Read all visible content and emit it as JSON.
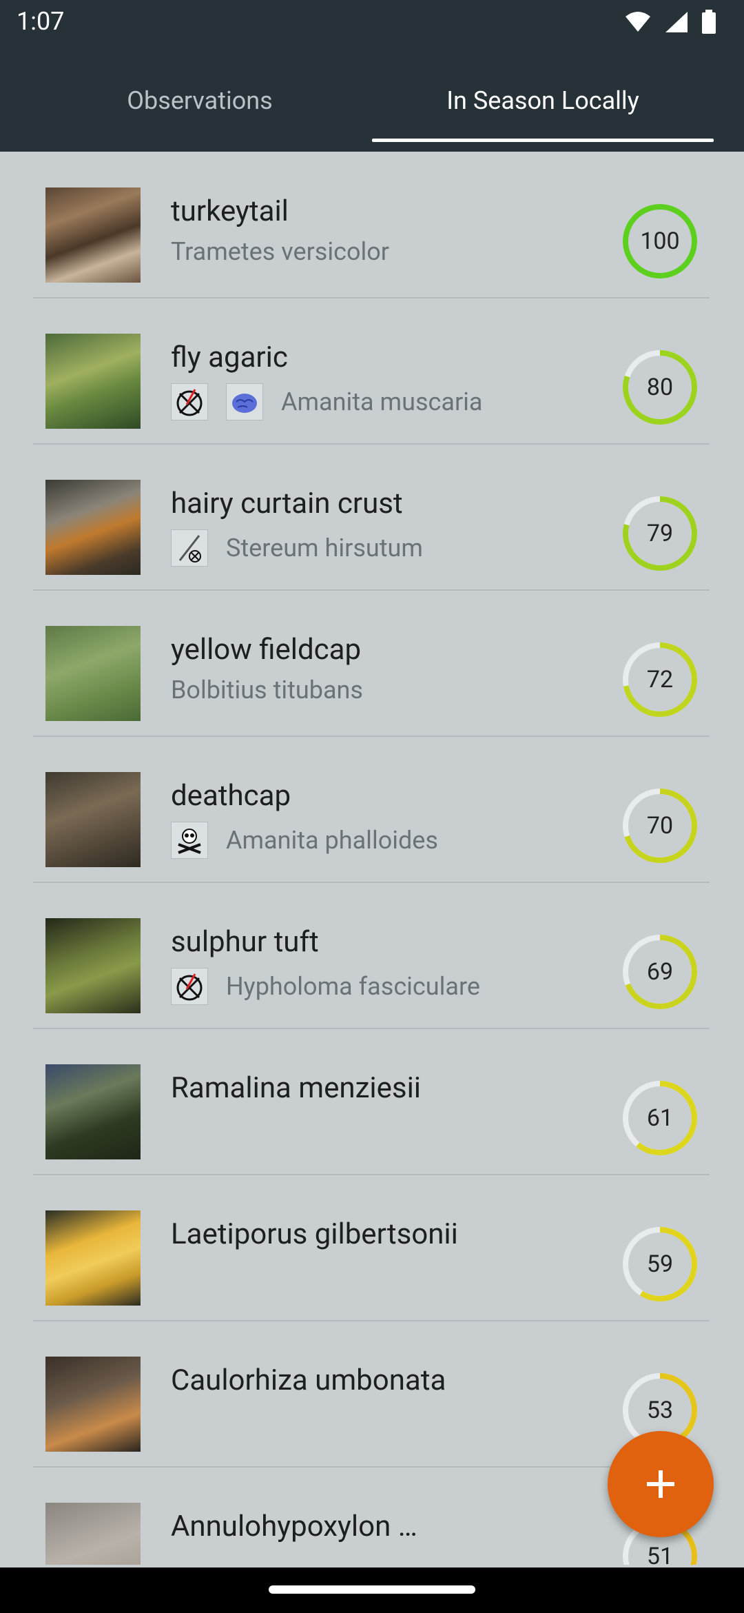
{
  "status": {
    "time": "1:07"
  },
  "tabs": [
    {
      "label": "Observations",
      "active": false
    },
    {
      "label": "In Season Locally",
      "active": true
    }
  ],
  "items": [
    {
      "name": "turkeytail",
      "latin": "Trametes versicolor",
      "score": 100,
      "color": "#5ccf1f",
      "badges": []
    },
    {
      "name": "fly agaric",
      "latin": "Amanita muscaria",
      "score": 80,
      "color": "#9bd31f",
      "badges": [
        "not-edible-icon",
        "psychoactive-brain-icon"
      ]
    },
    {
      "name": "hairy curtain crust",
      "latin": "Stereum hirsutum",
      "score": 79,
      "color": "#9fd21f",
      "badges": [
        "inedible-small-icon"
      ]
    },
    {
      "name": "yellow fieldcap",
      "latin": "Bolbitius titubans",
      "score": 72,
      "color": "#bfd51e",
      "badges": []
    },
    {
      "name": "deathcap",
      "latin": "Amanita phalloides",
      "score": 70,
      "color": "#c7d41e",
      "badges": [
        "poison-skull-icon"
      ]
    },
    {
      "name": "sulphur tuft",
      "latin": "Hypholoma fasciculare",
      "score": 69,
      "color": "#cad41e",
      "badges": [
        "not-edible-icon"
      ]
    },
    {
      "name": "Ramalina menziesii",
      "latin": "",
      "score": 61,
      "color": "#dcd61c",
      "badges": []
    },
    {
      "name": "Laetiporus gilbertsonii",
      "latin": "",
      "score": 59,
      "color": "#e0d41c",
      "badges": []
    },
    {
      "name": "Caulorhiza umbonata",
      "latin": "",
      "score": 53,
      "color": "#e6c61b",
      "badges": []
    },
    {
      "name": "Annulohypoxylon …",
      "latin": "",
      "score": 51,
      "color": "#e8be1b",
      "badges": []
    }
  ],
  "fab": {
    "icon": "plus-icon"
  }
}
